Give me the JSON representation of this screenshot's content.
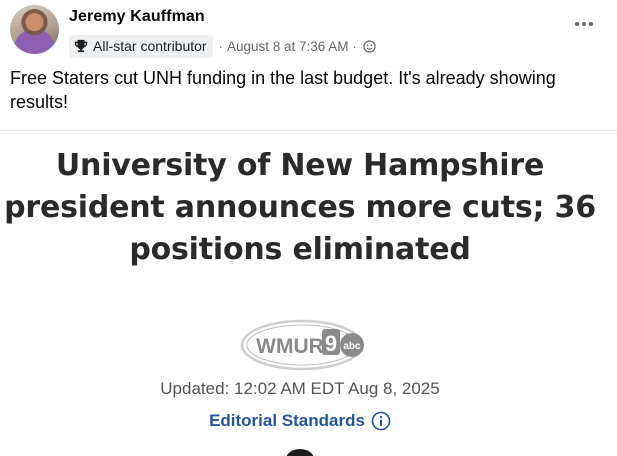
{
  "post": {
    "author": "Jeremy Kauffman",
    "badge": "All-star contributor",
    "separator1": "·",
    "date": "August 8 at 7:36 AM",
    "separator2": "·",
    "audience_icon": "globe-icon",
    "badge_icon": "trophy-icon",
    "menu_icon": "more-options-icon",
    "text": "Free Staters cut UNH funding in the last budget. It's already showing results!"
  },
  "article": {
    "headline": "University of New Hampshire president announces more cuts; 36 positions eliminated",
    "logo_text": "WMUR",
    "logo_number": "9",
    "logo_network": "abc",
    "updated": "Updated: 12:02 AM EDT Aug 8, 2025",
    "standards_link": "Editorial Standards",
    "standards_icon": "info-icon"
  },
  "colors": {
    "name_text": "#050505",
    "meta_text": "#65676b",
    "badge_bg": "#eef0f2",
    "link_blue": "#25569c",
    "headline_text": "#2a2a2a"
  }
}
